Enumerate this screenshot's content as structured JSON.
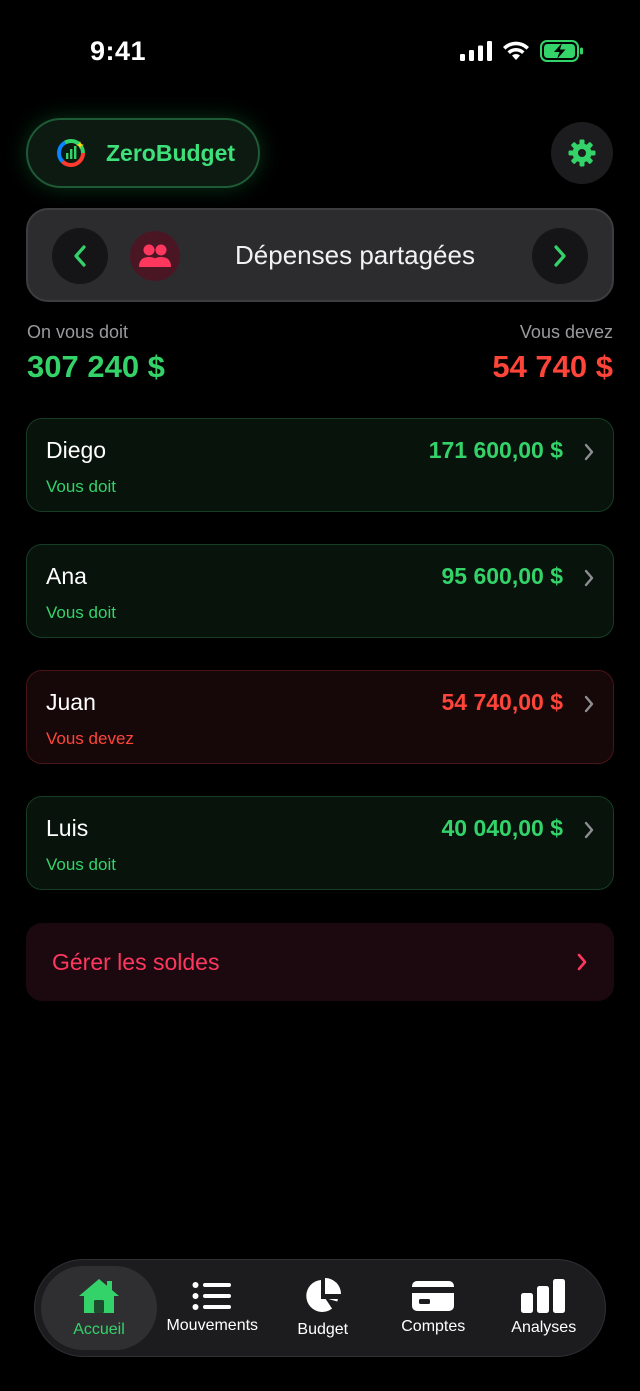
{
  "status_bar": {
    "time": "9:41"
  },
  "header": {
    "brand_name": "ZeroBudget"
  },
  "selector": {
    "title": "Dépenses partagées"
  },
  "totals": {
    "owed_to_you_label": "On vous doit",
    "owed_to_you_value": "307 240 $",
    "you_owe_label": "Vous devez",
    "you_owe_value": "54 740 $"
  },
  "people": [
    {
      "name": "Diego",
      "amount": "171 600,00 $",
      "status": "Vous doit",
      "direction": "owes_you"
    },
    {
      "name": "Ana",
      "amount": "95 600,00 $",
      "status": "Vous doit",
      "direction": "owes_you"
    },
    {
      "name": "Juan",
      "amount": "54 740,00 $",
      "status": "Vous devez",
      "direction": "you_owe"
    },
    {
      "name": "Luis",
      "amount": "40 040,00 $",
      "status": "Vous doit",
      "direction": "owes_you"
    }
  ],
  "manage": {
    "label": "Gérer les soldes"
  },
  "tabs": [
    {
      "label": "Accueil",
      "icon": "home-icon",
      "active": true
    },
    {
      "label": "Mouvements",
      "icon": "list-icon",
      "active": false
    },
    {
      "label": "Budget",
      "icon": "pie-chart-icon",
      "active": false
    },
    {
      "label": "Comptes",
      "icon": "credit-card-icon",
      "active": false
    },
    {
      "label": "Analyses",
      "icon": "bar-chart-icon",
      "active": false
    }
  ],
  "colors": {
    "positive": "#34d36a",
    "negative": "#ff453a",
    "accent_pink": "#ff375f",
    "background": "#000000"
  }
}
